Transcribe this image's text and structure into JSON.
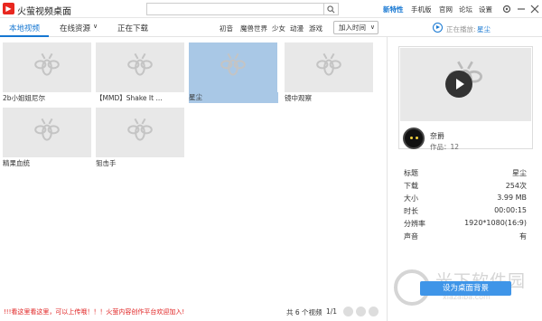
{
  "app": {
    "title": "火萤视频桌面",
    "logo_glyph": "▶"
  },
  "topnav": [
    {
      "label": "新特性",
      "active": true
    },
    {
      "label": "手机版"
    },
    {
      "label": "官网"
    },
    {
      "label": "论坛"
    },
    {
      "label": "设置"
    }
  ],
  "tabs": [
    {
      "label": "本地视频",
      "active": true
    },
    {
      "label": "在线资源"
    },
    {
      "label": "正在下载"
    }
  ],
  "online_chevron": "∨",
  "categories": [
    "初音",
    "魔兽世界",
    "少女",
    "动漫",
    "游戏"
  ],
  "sort": {
    "label": "加入时间",
    "chevron": "∨"
  },
  "now_playing": {
    "label": "正在播放:",
    "title": "星尘"
  },
  "videos": [
    {
      "title": "2b小姐姐尼尔",
      "selected": false
    },
    {
      "title": "【MMD】Shake It ...",
      "selected": false
    },
    {
      "title": "星尘",
      "selected": true
    },
    {
      "title": "镜中观察",
      "selected": false
    },
    {
      "title": "精果血统",
      "selected": false
    },
    {
      "title": "狙击手",
      "selected": false
    }
  ],
  "footer": {
    "notice": "!!!看这里看这里，可以上传哦！！！火萤内容创作平台欢迎加入!",
    "count": "共 6 个视频",
    "page": "1/1"
  },
  "detail": {
    "author": "奈爵",
    "works": "作品：12",
    "rows": [
      {
        "label": "标题",
        "value": "星尘"
      },
      {
        "label": "下载",
        "value": "254次"
      },
      {
        "label": "大小",
        "value": "3.99 MB"
      },
      {
        "label": "时长",
        "value": "00:00:15"
      },
      {
        "label": "分辨率",
        "value": "1920*1080(16:9)"
      },
      {
        "label": "声音",
        "value": "有"
      }
    ],
    "set_button": "设为桌面背景"
  },
  "watermark": {
    "text": "光下软件园",
    "sub": "xiazaiba.com"
  },
  "colors": {
    "accent": "#1677d2",
    "button": "#3f95e8",
    "selected": "#a9c8e6",
    "notice": "#e02020"
  }
}
